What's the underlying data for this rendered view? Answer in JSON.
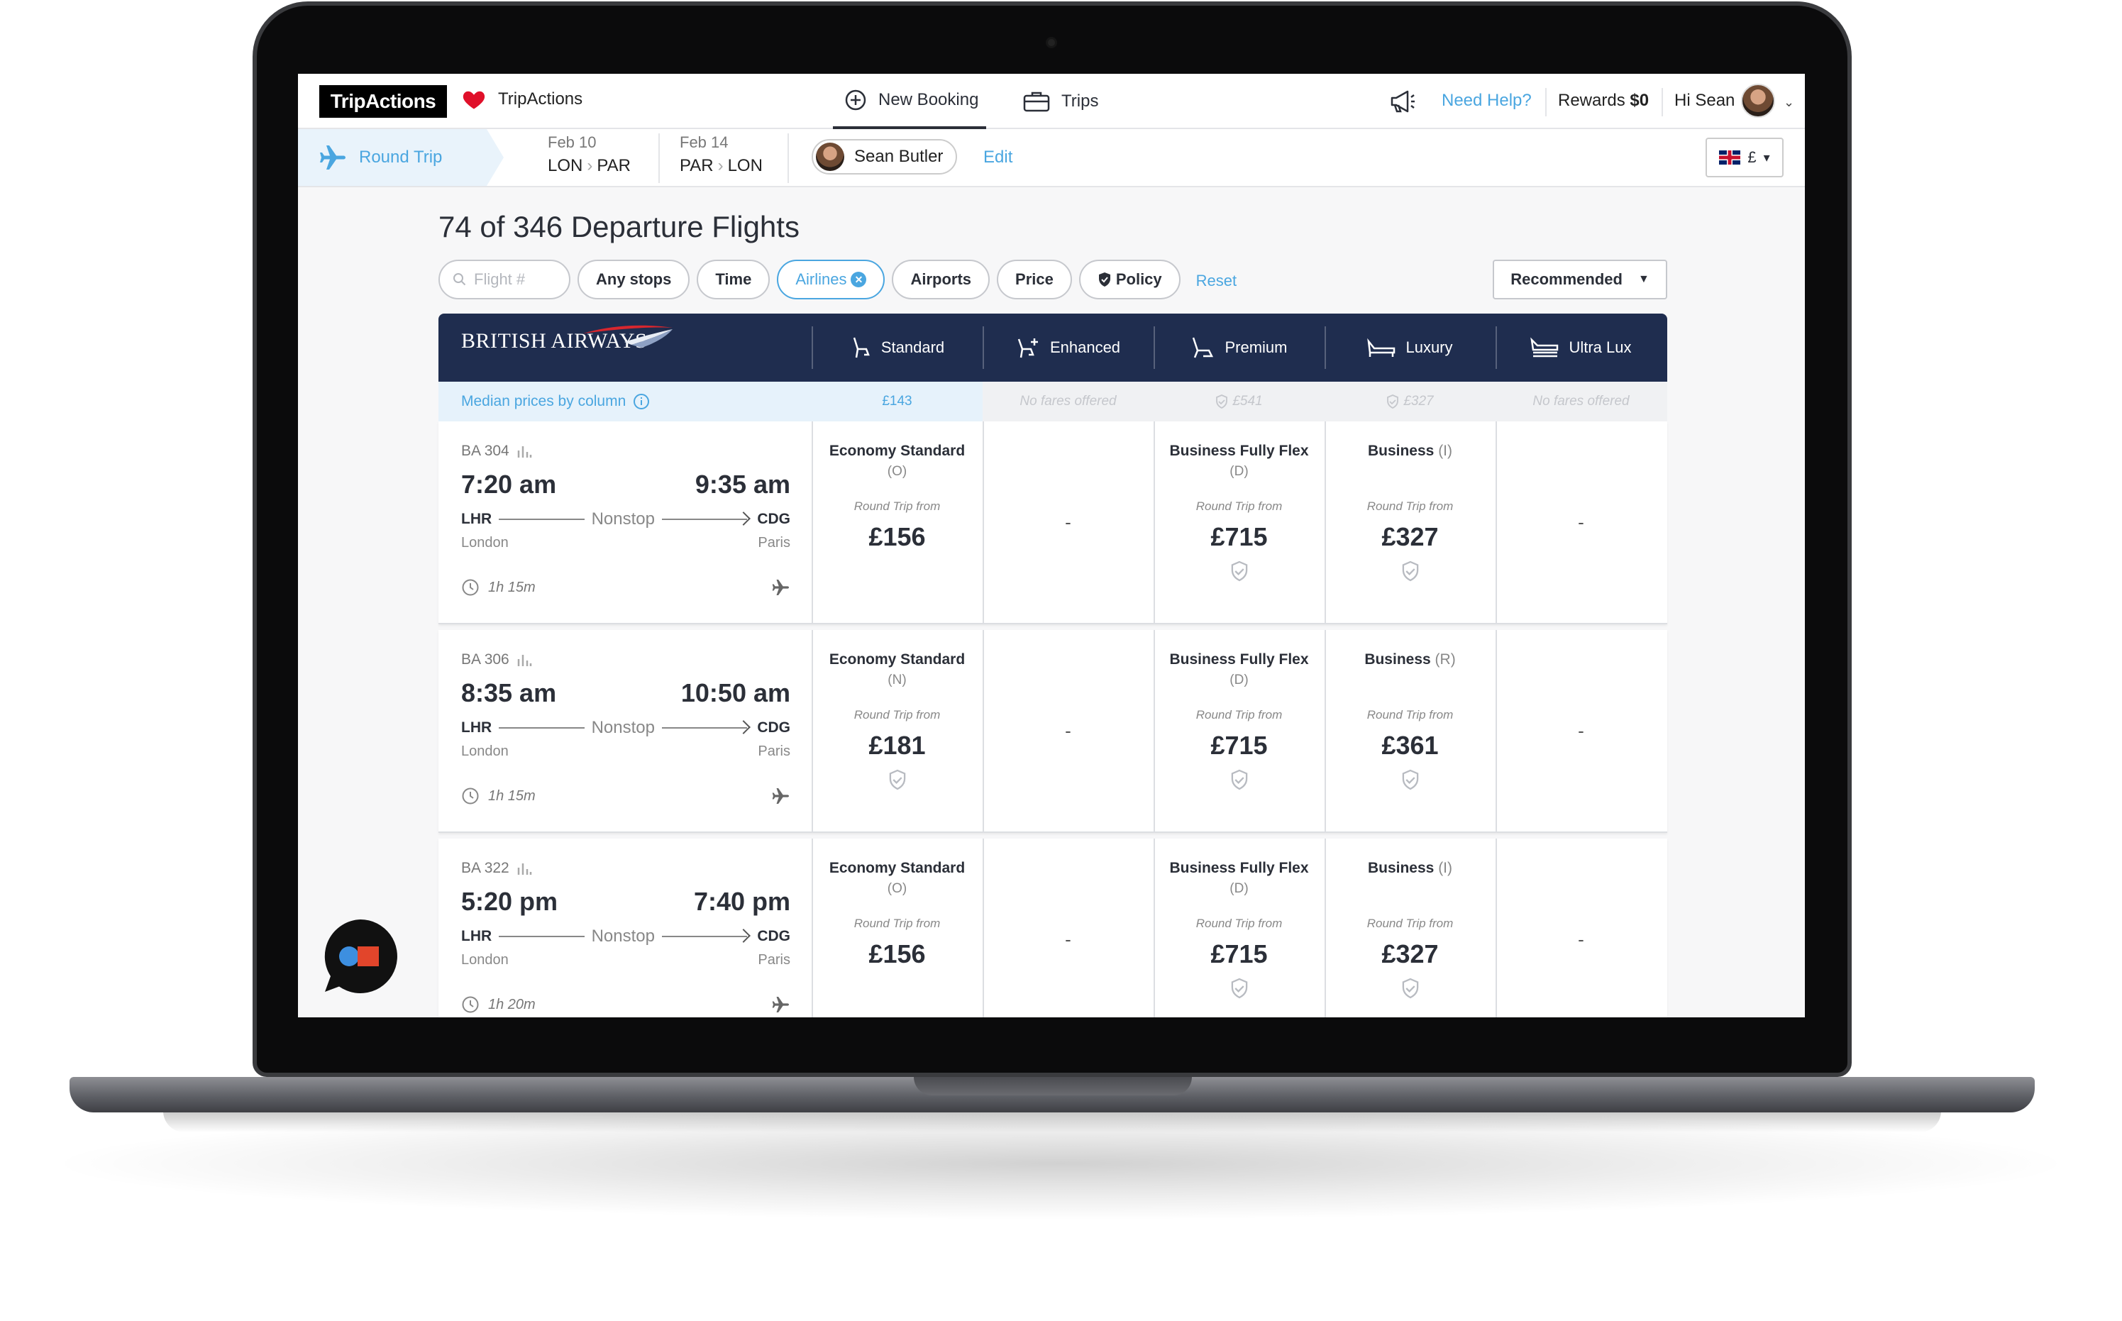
{
  "nav": {
    "logo": "TripActions",
    "brand": "TripActions",
    "new_booking": "New Booking",
    "trips": "Trips",
    "need_help": "Need Help?",
    "rewards_label": "Rewards",
    "rewards_value": "$0",
    "greeting": "Hi Sean"
  },
  "subbar": {
    "trip_type": "Round Trip",
    "legs": [
      {
        "date": "Feb 10",
        "from": "LON",
        "to": "PAR"
      },
      {
        "date": "Feb 14",
        "from": "PAR",
        "to": "LON"
      }
    ],
    "traveler": "Sean Butler",
    "edit": "Edit",
    "currency_symbol": "£"
  },
  "results": {
    "title": "74 of 346 Departure Flights",
    "search_placeholder": "Flight #",
    "filters": [
      "Any stops",
      "Time",
      "Airlines",
      "Airports",
      "Price",
      "Policy"
    ],
    "reset": "Reset",
    "sort": "Recommended"
  },
  "table": {
    "airline": "BRITISH AIRWAYS",
    "columns": [
      "Standard",
      "Enhanced",
      "Premium",
      "Luxury",
      "Ultra Lux"
    ],
    "median_label": "Median prices by column",
    "medians": [
      "£143",
      "No fares offered",
      "£541",
      "£327",
      "No fares offered"
    ],
    "round_trip_from": "Round Trip from",
    "empty": "-",
    "rows": [
      {
        "flight": "BA 304",
        "depart": "7:20 am",
        "arrive": "9:35 am",
        "from": "LHR",
        "to": "CDG",
        "stops": "Nonstop",
        "from_city": "London",
        "to_city": "Paris",
        "duration": "1h 15m",
        "standard": {
          "cls": "Economy Standard",
          "code": "(O)",
          "price": "£156"
        },
        "premium": {
          "cls": "Business Fully Flex",
          "code": "(D)",
          "price": "£715"
        },
        "luxury": {
          "cls": "Business",
          "code": "(I)",
          "price": "£327"
        }
      },
      {
        "flight": "BA 306",
        "depart": "8:35 am",
        "arrive": "10:50 am",
        "from": "LHR",
        "to": "CDG",
        "stops": "Nonstop",
        "from_city": "London",
        "to_city": "Paris",
        "duration": "1h 15m",
        "standard": {
          "cls": "Economy Standard",
          "code": "(N)",
          "price": "£181"
        },
        "premium": {
          "cls": "Business Fully Flex",
          "code": "(D)",
          "price": "£715"
        },
        "luxury": {
          "cls": "Business",
          "code": "(R)",
          "price": "£361"
        }
      },
      {
        "flight": "BA 322",
        "depart": "5:20 pm",
        "arrive": "7:40 pm",
        "from": "LHR",
        "to": "CDG",
        "stops": "Nonstop",
        "from_city": "London",
        "to_city": "Paris",
        "duration": "1h 20m",
        "standard": {
          "cls": "Economy Standard",
          "code": "(O)",
          "price": "£156"
        },
        "premium": {
          "cls": "Business Fully Flex",
          "code": "(D)",
          "price": "£715"
        },
        "luxury": {
          "cls": "Business",
          "code": "(I)",
          "price": "£327"
        }
      }
    ]
  },
  "colors": {
    "accent": "#4aa6e0",
    "header_navy": "#1f2d4f",
    "heart": "#e0102a"
  }
}
